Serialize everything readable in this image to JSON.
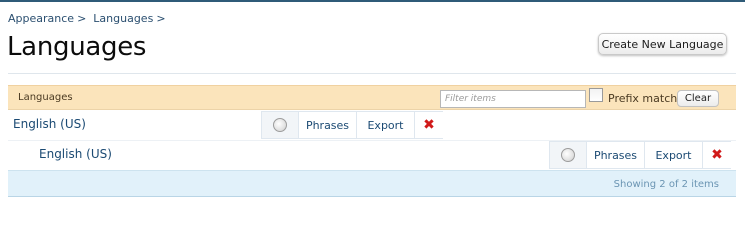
{
  "breadcrumb": {
    "items": [
      "Appearance",
      "Languages"
    ],
    "separator": ">"
  },
  "page": {
    "title": "Languages",
    "create_button": "Create New Language"
  },
  "list": {
    "header_label": "Languages",
    "filter_placeholder": "Filter items",
    "prefix_match_label": "Prefix match",
    "prefix_match_checked": false,
    "clear_label": "Clear",
    "rows": [
      {
        "name": "English (US)",
        "phrases_label": "Phrases",
        "export_label": "Export",
        "delete_icon": "delete-x-icon"
      },
      {
        "name": "English (US)",
        "phrases_label": "Phrases",
        "export_label": "Export",
        "delete_icon": "delete-x-icon"
      }
    ],
    "footer_text": "Showing 2 of 2 items"
  },
  "colors": {
    "header_bg": "#fbe4bb",
    "footer_bg": "#e1f1fa",
    "link": "#1b4a73",
    "delete": "#d11a1a"
  }
}
